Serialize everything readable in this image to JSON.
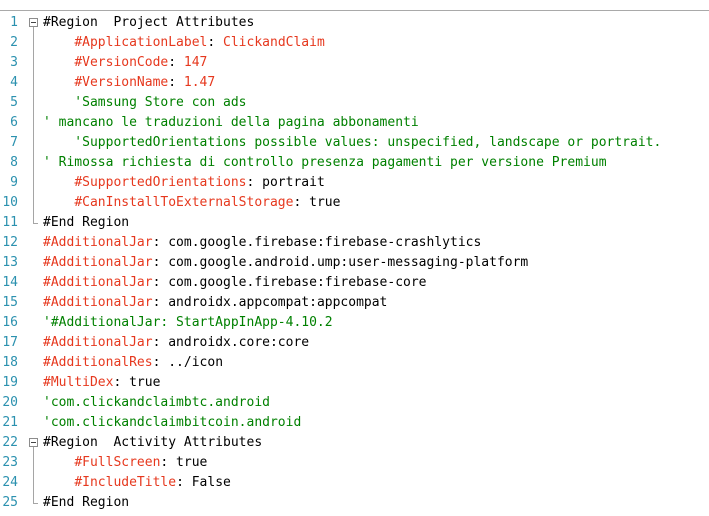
{
  "lines": [
    {
      "num": "1",
      "parts": [
        {
          "t": "#Region  Project Attributes",
          "c": "plain"
        }
      ]
    },
    {
      "num": "2",
      "parts": [
        {
          "t": "    ",
          "c": "plain"
        },
        {
          "t": "#ApplicationLabel",
          "c": "kw"
        },
        {
          "t": ": ",
          "c": "val"
        },
        {
          "t": "ClickandClaim",
          "c": "kw"
        }
      ]
    },
    {
      "num": "3",
      "parts": [
        {
          "t": "    ",
          "c": "plain"
        },
        {
          "t": "#VersionCode",
          "c": "kw"
        },
        {
          "t": ": ",
          "c": "val"
        },
        {
          "t": "147",
          "c": "kw"
        }
      ]
    },
    {
      "num": "4",
      "parts": [
        {
          "t": "    ",
          "c": "plain"
        },
        {
          "t": "#VersionName",
          "c": "kw"
        },
        {
          "t": ": ",
          "c": "val"
        },
        {
          "t": "1.47",
          "c": "kw"
        }
      ]
    },
    {
      "num": "5",
      "parts": [
        {
          "t": "    'Samsung Store con ads",
          "c": "cm"
        }
      ]
    },
    {
      "num": "6",
      "parts": [
        {
          "t": "' mancano le traduzioni della pagina abbonamenti",
          "c": "cm"
        }
      ]
    },
    {
      "num": "7",
      "parts": [
        {
          "t": "    'SupportedOrientations possible values: unspecified, landscape or portrait.",
          "c": "cm"
        }
      ]
    },
    {
      "num": "8",
      "parts": [
        {
          "t": "' Rimossa richiesta di controllo presenza pagamenti per versione Premium",
          "c": "cm"
        }
      ]
    },
    {
      "num": "9",
      "parts": [
        {
          "t": "    ",
          "c": "plain"
        },
        {
          "t": "#SupportedOrientations",
          "c": "kw"
        },
        {
          "t": ": portrait",
          "c": "val"
        }
      ]
    },
    {
      "num": "10",
      "parts": [
        {
          "t": "    ",
          "c": "plain"
        },
        {
          "t": "#CanInstallToExternalStorage",
          "c": "kw"
        },
        {
          "t": ": true",
          "c": "val"
        }
      ]
    },
    {
      "num": "11",
      "parts": [
        {
          "t": "#End Region",
          "c": "plain"
        }
      ]
    },
    {
      "num": "12",
      "parts": [
        {
          "t": "#AdditionalJar",
          "c": "kw"
        },
        {
          "t": ": com.google.firebase:firebase-crashlytics",
          "c": "val"
        }
      ]
    },
    {
      "num": "13",
      "parts": [
        {
          "t": "#AdditionalJar",
          "c": "kw"
        },
        {
          "t": ": com.google.android.ump:user-messaging-platform",
          "c": "val"
        }
      ]
    },
    {
      "num": "14",
      "parts": [
        {
          "t": "#AdditionalJar",
          "c": "kw"
        },
        {
          "t": ": com.google.firebase:firebase-core",
          "c": "val"
        }
      ]
    },
    {
      "num": "15",
      "parts": [
        {
          "t": "#AdditionalJar",
          "c": "kw"
        },
        {
          "t": ": androidx.appcompat:appcompat",
          "c": "val"
        }
      ]
    },
    {
      "num": "16",
      "parts": [
        {
          "t": "'#AdditionalJar: StartAppInApp-4.10.2",
          "c": "cm"
        }
      ]
    },
    {
      "num": "17",
      "parts": [
        {
          "t": "#AdditionalJar",
          "c": "kw"
        },
        {
          "t": ": androidx.core:core",
          "c": "val"
        }
      ]
    },
    {
      "num": "18",
      "parts": [
        {
          "t": "#AdditionalRes",
          "c": "kw"
        },
        {
          "t": ": ../icon",
          "c": "val"
        }
      ]
    },
    {
      "num": "19",
      "parts": [
        {
          "t": "#MultiDex",
          "c": "kw"
        },
        {
          "t": ": true",
          "c": "val"
        }
      ]
    },
    {
      "num": "20",
      "parts": [
        {
          "t": "'com.clickandclaimbtc.android",
          "c": "cm"
        }
      ]
    },
    {
      "num": "21",
      "parts": [
        {
          "t": "'com.clickandclaimbitcoin.android",
          "c": "cm"
        }
      ]
    },
    {
      "num": "22",
      "parts": [
        {
          "t": "#Region  Activity Attributes",
          "c": "plain"
        }
      ]
    },
    {
      "num": "23",
      "parts": [
        {
          "t": "    ",
          "c": "plain"
        },
        {
          "t": "#FullScreen",
          "c": "kw"
        },
        {
          "t": ": true",
          "c": "val"
        }
      ]
    },
    {
      "num": "24",
      "parts": [
        {
          "t": "    ",
          "c": "plain"
        },
        {
          "t": "#IncludeTitle",
          "c": "kw"
        },
        {
          "t": ": False",
          "c": "val"
        }
      ]
    },
    {
      "num": "25",
      "parts": [
        {
          "t": "#End Region",
          "c": "plain"
        }
      ]
    }
  ],
  "folds": [
    {
      "start": 1,
      "end": 11
    },
    {
      "start": 22,
      "end": 25
    }
  ]
}
